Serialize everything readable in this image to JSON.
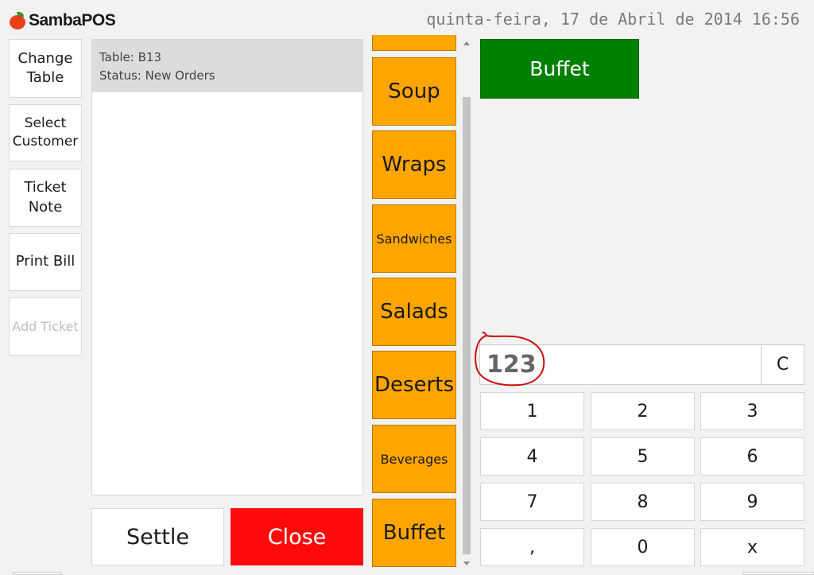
{
  "app": {
    "name": "SambaPOS"
  },
  "header": {
    "datetime": "quinta-feira, 17 de Abril de 2014 16:56"
  },
  "sidebar": {
    "buttons": [
      {
        "label": "Change Table"
      },
      {
        "label": "Select Customer"
      },
      {
        "label": "Ticket Note"
      },
      {
        "label": "Print Bill"
      },
      {
        "label": "Add Ticket",
        "disabled": true
      }
    ]
  },
  "ticket": {
    "table_line": "Table: B13",
    "status_line": "Status: New Orders"
  },
  "actions": {
    "settle": "Settle",
    "close": "Close"
  },
  "categories": {
    "items": [
      {
        "label": ""
      },
      {
        "label": "Soup"
      },
      {
        "label": "Wraps"
      },
      {
        "label": "Sandwiches"
      },
      {
        "label": "Salads"
      },
      {
        "label": "Deserts"
      },
      {
        "label": "Beverages"
      },
      {
        "label": "Buffet"
      }
    ]
  },
  "products": {
    "items": [
      {
        "label": "Buffet"
      }
    ]
  },
  "numpad": {
    "display": "123",
    "clear": "C",
    "keys": [
      "1",
      "2",
      "3",
      "4",
      "5",
      "6",
      "7",
      "8",
      "9",
      ",",
      "0",
      "x"
    ]
  },
  "colors": {
    "category": "#ffa500",
    "product": "#008000",
    "close": "#ff0a0a",
    "annotation": "#cc1111"
  }
}
